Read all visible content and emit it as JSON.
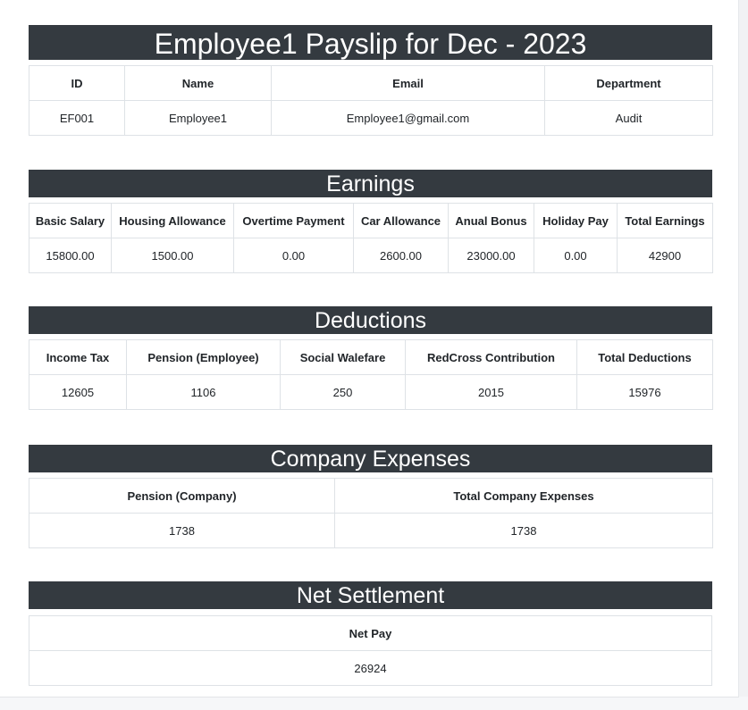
{
  "header": {
    "title": "Employee1 Payslip for Dec - 2023"
  },
  "employee": {
    "headers": [
      "ID",
      "Name",
      "Email",
      "Department"
    ],
    "values": [
      "EF001",
      "Employee1",
      "Employee1@gmail.com",
      "Audit"
    ]
  },
  "earnings": {
    "title": "Earnings",
    "headers": [
      "Basic Salary",
      "Housing Allowance",
      "Overtime Payment",
      "Car Allowance",
      "Anual Bonus",
      "Holiday Pay",
      "Total Earnings"
    ],
    "values": [
      "15800.00",
      "1500.00",
      "0.00",
      "2600.00",
      "23000.00",
      "0.00",
      "42900"
    ]
  },
  "deductions": {
    "title": "Deductions",
    "headers": [
      "Income Tax",
      "Pension (Employee)",
      "Social Walefare",
      "RedCross Contribution",
      "Total Deductions"
    ],
    "values": [
      "12605",
      "1106",
      "250",
      "2015",
      "15976"
    ]
  },
  "company_expenses": {
    "title": "Company Expenses",
    "headers": [
      "Pension (Company)",
      "Total Company Expenses"
    ],
    "values": [
      "1738",
      "1738"
    ]
  },
  "net_settlement": {
    "title": "Net Settlement",
    "headers": [
      "Net Pay"
    ],
    "values": [
      "26924"
    ]
  },
  "colors": {
    "banner_background": "#343a40",
    "banner_text": "#ffffff",
    "border": "#dee2e6",
    "page_background": "#ffffff"
  }
}
